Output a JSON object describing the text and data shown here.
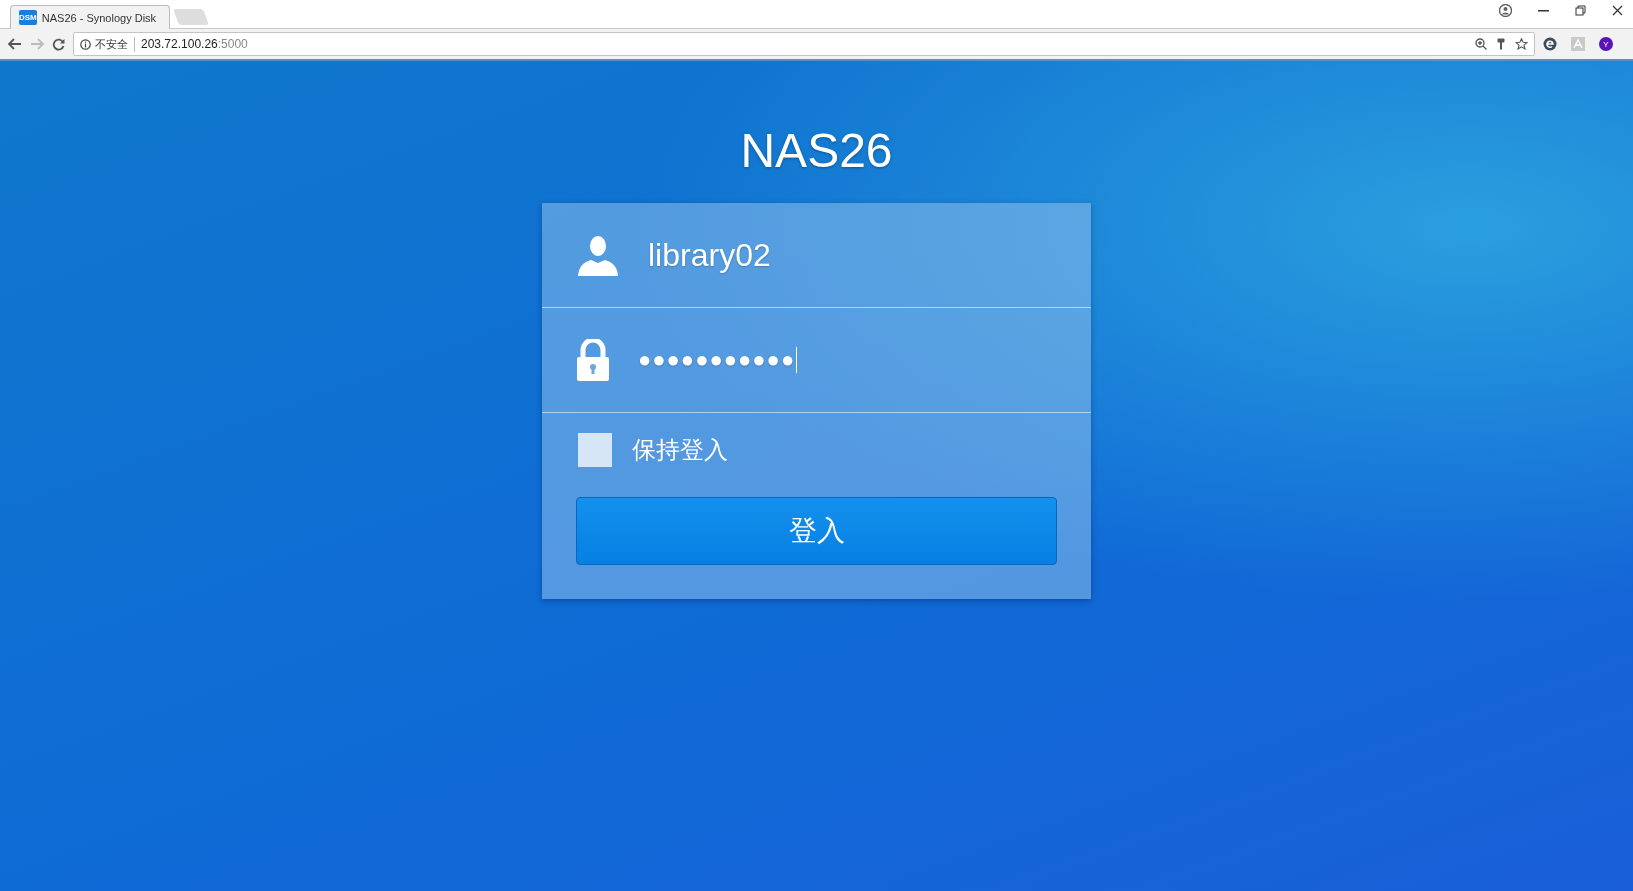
{
  "browser": {
    "tabs": [
      {
        "title": "NAS26 - Synology Disk",
        "favicon": "DSM",
        "selected": true
      }
    ],
    "security_label": "不安全",
    "url_host": "203.72.100.26",
    "url_port": ":5000",
    "extension_avatar": "Y"
  },
  "login": {
    "title": "NAS26",
    "username": "library02",
    "password": "●●●●●●●●●●●",
    "remember_me": {
      "label": "保持登入",
      "checked": false
    },
    "submit": "登入"
  }
}
